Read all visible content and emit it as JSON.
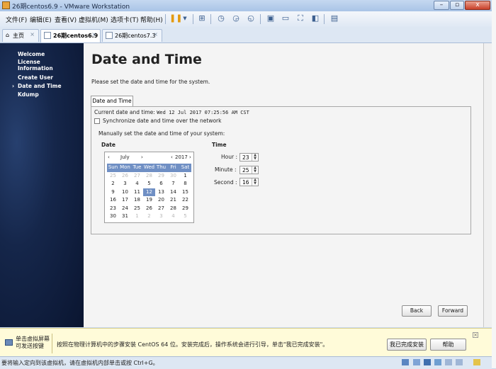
{
  "window": {
    "title": "26期centos6.9 - VMware Workstation",
    "minimize_glyph": "–",
    "maximize_glyph": "▫",
    "close_glyph": "x"
  },
  "menubar": {
    "items": [
      "文件(F)",
      "编辑(E)",
      "查看(V)",
      "虚拟机(M)",
      "选项卡(T)",
      "帮助(H)"
    ]
  },
  "toolbar": {
    "icons": [
      "pause-icon",
      "dropdown-icon",
      "send-keys-icon",
      "snapshot-icon",
      "revert-snapshot-icon",
      "snapshot-manager-icon",
      "full-console-icon",
      "thumbnail-icon",
      "fullscreen-icon",
      "unity-icon",
      "library-icon"
    ]
  },
  "tabs": [
    {
      "label": "主页",
      "active": false
    },
    {
      "label": "26期centos6.9",
      "active": true
    },
    {
      "label": "26期centos7.3",
      "active": false
    }
  ],
  "tab_close_glyph": "×",
  "installer": {
    "nav": [
      {
        "label": "Welcome",
        "current": false
      },
      {
        "label": "License",
        "current": false
      },
      {
        "label": "Information",
        "current": false
      },
      {
        "label": "Create User",
        "current": false
      },
      {
        "label": "Date and Time",
        "current": true
      },
      {
        "label": "Kdump",
        "current": false
      }
    ],
    "current_marker": "›",
    "title": "Date and Time",
    "description": "Please set the date and time for the system.",
    "tab_label": "Date and Time",
    "current_datetime_label": "Current date and time:",
    "current_datetime_value": "Wed 12 Jul 2017 07:25:56 AM CST",
    "sync_label": "Synchronize date and time over the network",
    "sync_checked": false,
    "manual_label": "Manually set the date and time of your system:",
    "date_heading": "Date",
    "time_heading": "Time",
    "calendar": {
      "month": "July",
      "year": "2017",
      "prev_glyph": "‹",
      "next_glyph": "›",
      "weekdays": [
        "Sun",
        "Mon",
        "Tue",
        "Wed",
        "Thu",
        "Fri",
        "Sat"
      ],
      "weeks": [
        [
          "25",
          "26",
          "27",
          "28",
          "29",
          "30",
          "1"
        ],
        [
          "2",
          "3",
          "4",
          "5",
          "6",
          "7",
          "8"
        ],
        [
          "9",
          "10",
          "11",
          "12",
          "13",
          "14",
          "15"
        ],
        [
          "16",
          "17",
          "18",
          "19",
          "20",
          "21",
          "22"
        ],
        [
          "23",
          "24",
          "25",
          "26",
          "27",
          "28",
          "29"
        ],
        [
          "30",
          "31",
          "1",
          "2",
          "3",
          "4",
          "5"
        ]
      ],
      "selected": "12"
    },
    "time": {
      "hour_label": "Hour :",
      "hour": "23",
      "minute_label": "Minute :",
      "minute": "25",
      "second_label": "Second :",
      "second": "16"
    },
    "back_label": "Back",
    "forward_label": "Forward"
  },
  "infobar": {
    "left_text_line1": "单击虚拟屏幕",
    "left_text_line2": "可发送按键",
    "message": "按照在物理计算机中的步骤安装 CentOS 64 位。安装完成后，操作系统会进行引导，单击\"我已完成安装\"。",
    "done_button": "我已完成安装",
    "help_button": "帮助",
    "close_glyph": "×"
  },
  "statusbar": {
    "text": "要将输入定向到该虚拟机，请在虚拟机内部单击或按 Ctrl+G。"
  },
  "colors": {
    "accent": "#6f8fc4",
    "sidebar_dark": "#15264a"
  }
}
